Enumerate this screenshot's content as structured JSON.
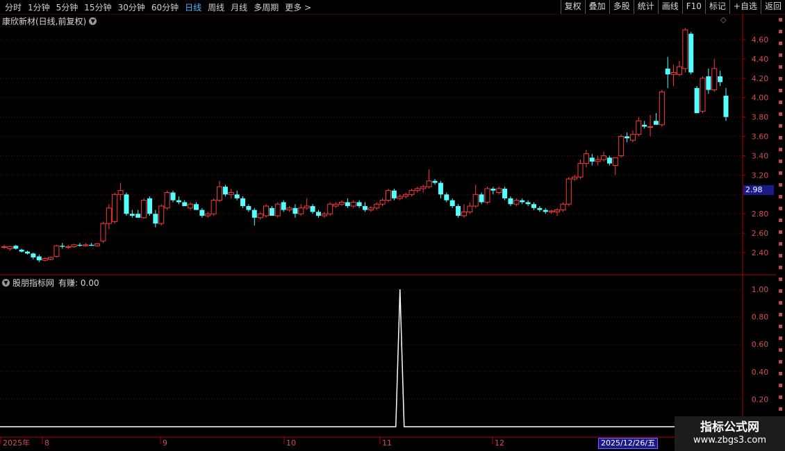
{
  "toolbar": {
    "periods": [
      "分时",
      "1分钟",
      "5分钟",
      "15分钟",
      "30分钟",
      "60分钟",
      "日线",
      "周线",
      "月线",
      "多周期",
      "更多 >"
    ],
    "active_period": "日线",
    "actions": [
      "复权",
      "叠加",
      "多股",
      "统计",
      "画线",
      "F10",
      "标记",
      "+自选",
      "返回"
    ]
  },
  "stock": {
    "title": "康欣新材(日线,前复权)",
    "current_price_tag": "2.98"
  },
  "price_axis": {
    "labels": [
      "4.60",
      "4.40",
      "4.20",
      "4.00",
      "3.80",
      "3.60",
      "3.40",
      "3.20",
      "2.80",
      "2.60",
      "2.40"
    ]
  },
  "indicator": {
    "title": "股朋指标网",
    "value_text": "有赚: 0.00",
    "axis_labels": [
      "1.00",
      "0.80",
      "0.60",
      "0.40",
      "0.20"
    ]
  },
  "date_axis": {
    "labels": [
      "2025年",
      "8",
      "9",
      "10",
      "11",
      "12"
    ],
    "selected_date": "2025/12/26/五"
  },
  "watermark": {
    "title": "指标公式网",
    "url": "www.zbgs3.com"
  },
  "colors": {
    "up": "#ff3b3b",
    "down": "#54ffff",
    "grid": "#800000",
    "indicator_line": "#ffffff",
    "active": "#4fb4ff"
  },
  "chart_data": {
    "type": "candlestick",
    "title": "康欣新材(日线,前复权)",
    "ylim": [
      2.25,
      4.8
    ],
    "candles": [
      {
        "o": 2.46,
        "h": 2.48,
        "l": 2.44,
        "c": 2.46
      },
      {
        "o": 2.44,
        "h": 2.47,
        "l": 2.42,
        "c": 2.46
      },
      {
        "o": 2.47,
        "h": 2.48,
        "l": 2.43,
        "c": 2.44
      },
      {
        "o": 2.43,
        "h": 2.44,
        "l": 2.4,
        "c": 2.41
      },
      {
        "o": 2.41,
        "h": 2.42,
        "l": 2.38,
        "c": 2.39
      },
      {
        "o": 2.39,
        "h": 2.4,
        "l": 2.33,
        "c": 2.35
      },
      {
        "o": 2.36,
        "h": 2.38,
        "l": 2.3,
        "c": 2.32
      },
      {
        "o": 2.32,
        "h": 2.35,
        "l": 2.31,
        "c": 2.34
      },
      {
        "o": 2.33,
        "h": 2.36,
        "l": 2.32,
        "c": 2.35
      },
      {
        "o": 2.36,
        "h": 2.48,
        "l": 2.35,
        "c": 2.47
      },
      {
        "o": 2.47,
        "h": 2.5,
        "l": 2.44,
        "c": 2.46
      },
      {
        "o": 2.46,
        "h": 2.48,
        "l": 2.44,
        "c": 2.46
      },
      {
        "o": 2.46,
        "h": 2.49,
        "l": 2.45,
        "c": 2.48
      },
      {
        "o": 2.48,
        "h": 2.5,
        "l": 2.46,
        "c": 2.47
      },
      {
        "o": 2.47,
        "h": 2.5,
        "l": 2.46,
        "c": 2.48
      },
      {
        "o": 2.48,
        "h": 2.5,
        "l": 2.47,
        "c": 2.47
      },
      {
        "o": 2.47,
        "h": 2.5,
        "l": 2.46,
        "c": 2.49
      },
      {
        "o": 2.52,
        "h": 2.72,
        "l": 2.5,
        "c": 2.7
      },
      {
        "o": 2.7,
        "h": 2.9,
        "l": 2.64,
        "c": 2.86
      },
      {
        "o": 2.72,
        "h": 3.02,
        "l": 2.7,
        "c": 3.0
      },
      {
        "o": 3.0,
        "h": 3.12,
        "l": 2.94,
        "c": 3.04
      },
      {
        "o": 3.0,
        "h": 3.02,
        "l": 2.78,
        "c": 2.8
      },
      {
        "o": 2.8,
        "h": 2.84,
        "l": 2.76,
        "c": 2.78
      },
      {
        "o": 2.8,
        "h": 2.84,
        "l": 2.76,
        "c": 2.76
      },
      {
        "o": 2.76,
        "h": 2.96,
        "l": 2.75,
        "c": 2.94
      },
      {
        "o": 2.96,
        "h": 2.98,
        "l": 2.78,
        "c": 2.8
      },
      {
        "o": 2.8,
        "h": 2.84,
        "l": 2.66,
        "c": 2.7
      },
      {
        "o": 2.7,
        "h": 2.9,
        "l": 2.68,
        "c": 2.88
      },
      {
        "o": 2.86,
        "h": 3.04,
        "l": 2.84,
        "c": 3.02
      },
      {
        "o": 3.02,
        "h": 3.04,
        "l": 2.92,
        "c": 2.94
      },
      {
        "o": 2.94,
        "h": 2.98,
        "l": 2.9,
        "c": 2.92
      },
      {
        "o": 2.92,
        "h": 2.94,
        "l": 2.88,
        "c": 2.88
      },
      {
        "o": 2.86,
        "h": 2.92,
        "l": 2.84,
        "c": 2.9
      },
      {
        "o": 2.9,
        "h": 2.92,
        "l": 2.84,
        "c": 2.84
      },
      {
        "o": 2.84,
        "h": 2.86,
        "l": 2.76,
        "c": 2.78
      },
      {
        "o": 2.78,
        "h": 2.82,
        "l": 2.76,
        "c": 2.8
      },
      {
        "o": 2.8,
        "h": 2.96,
        "l": 2.78,
        "c": 2.94
      },
      {
        "o": 2.94,
        "h": 3.14,
        "l": 2.92,
        "c": 3.08
      },
      {
        "o": 3.08,
        "h": 3.1,
        "l": 2.98,
        "c": 3.0
      },
      {
        "o": 3.0,
        "h": 3.06,
        "l": 2.96,
        "c": 3.02
      },
      {
        "o": 3.0,
        "h": 3.04,
        "l": 2.94,
        "c": 2.96
      },
      {
        "o": 2.96,
        "h": 2.98,
        "l": 2.86,
        "c": 2.88
      },
      {
        "o": 2.88,
        "h": 2.9,
        "l": 2.82,
        "c": 2.84
      },
      {
        "o": 2.84,
        "h": 2.86,
        "l": 2.68,
        "c": 2.76
      },
      {
        "o": 2.76,
        "h": 2.82,
        "l": 2.74,
        "c": 2.8
      },
      {
        "o": 2.78,
        "h": 2.9,
        "l": 2.76,
        "c": 2.88
      },
      {
        "o": 2.86,
        "h": 2.88,
        "l": 2.78,
        "c": 2.78
      },
      {
        "o": 2.78,
        "h": 2.92,
        "l": 2.76,
        "c": 2.9
      },
      {
        "o": 2.92,
        "h": 2.94,
        "l": 2.82,
        "c": 2.84
      },
      {
        "o": 2.84,
        "h": 2.88,
        "l": 2.82,
        "c": 2.86
      },
      {
        "o": 2.86,
        "h": 2.9,
        "l": 2.76,
        "c": 2.8
      },
      {
        "o": 2.8,
        "h": 2.9,
        "l": 2.78,
        "c": 2.86
      },
      {
        "o": 2.86,
        "h": 2.96,
        "l": 2.84,
        "c": 2.88
      },
      {
        "o": 2.88,
        "h": 2.9,
        "l": 2.8,
        "c": 2.82
      },
      {
        "o": 2.82,
        "h": 2.84,
        "l": 2.76,
        "c": 2.78
      },
      {
        "o": 2.78,
        "h": 2.82,
        "l": 2.76,
        "c": 2.8
      },
      {
        "o": 2.8,
        "h": 2.92,
        "l": 2.78,
        "c": 2.9
      },
      {
        "o": 2.88,
        "h": 2.92,
        "l": 2.86,
        "c": 2.9
      },
      {
        "o": 2.9,
        "h": 2.94,
        "l": 2.88,
        "c": 2.92
      },
      {
        "o": 2.92,
        "h": 2.96,
        "l": 2.86,
        "c": 2.88
      },
      {
        "o": 2.88,
        "h": 2.94,
        "l": 2.86,
        "c": 2.92
      },
      {
        "o": 2.92,
        "h": 2.94,
        "l": 2.86,
        "c": 2.88
      },
      {
        "o": 2.88,
        "h": 2.92,
        "l": 2.82,
        "c": 2.84
      },
      {
        "o": 2.84,
        "h": 2.88,
        "l": 2.82,
        "c": 2.86
      },
      {
        "o": 2.86,
        "h": 2.92,
        "l": 2.84,
        "c": 2.9
      },
      {
        "o": 2.9,
        "h": 2.96,
        "l": 2.88,
        "c": 2.94
      },
      {
        "o": 2.94,
        "h": 3.06,
        "l": 2.92,
        "c": 3.04
      },
      {
        "o": 3.04,
        "h": 3.06,
        "l": 2.94,
        "c": 2.96
      },
      {
        "o": 2.96,
        "h": 3.0,
        "l": 2.94,
        "c": 2.98
      },
      {
        "o": 2.98,
        "h": 3.02,
        "l": 2.96,
        "c": 3.0
      },
      {
        "o": 3.0,
        "h": 3.06,
        "l": 2.98,
        "c": 3.04
      },
      {
        "o": 3.04,
        "h": 3.08,
        "l": 3.02,
        "c": 3.06
      },
      {
        "o": 3.06,
        "h": 3.1,
        "l": 3.02,
        "c": 3.08
      },
      {
        "o": 3.08,
        "h": 3.26,
        "l": 3.06,
        "c": 3.14
      },
      {
        "o": 3.14,
        "h": 3.16,
        "l": 3.1,
        "c": 3.12
      },
      {
        "o": 3.12,
        "h": 3.14,
        "l": 2.96,
        "c": 3.0
      },
      {
        "o": 3.0,
        "h": 3.02,
        "l": 2.92,
        "c": 2.94
      },
      {
        "o": 2.94,
        "h": 2.96,
        "l": 2.86,
        "c": 2.88
      },
      {
        "o": 2.88,
        "h": 2.9,
        "l": 2.76,
        "c": 2.78
      },
      {
        "o": 2.78,
        "h": 2.9,
        "l": 2.76,
        "c": 2.82
      },
      {
        "o": 2.82,
        "h": 2.92,
        "l": 2.8,
        "c": 2.88
      },
      {
        "o": 2.88,
        "h": 3.1,
        "l": 2.86,
        "c": 3.0
      },
      {
        "o": 3.0,
        "h": 3.02,
        "l": 2.9,
        "c": 2.92
      },
      {
        "o": 2.92,
        "h": 3.08,
        "l": 2.9,
        "c": 3.06
      },
      {
        "o": 3.06,
        "h": 3.08,
        "l": 3.0,
        "c": 3.04
      },
      {
        "o": 3.02,
        "h": 3.08,
        "l": 3.0,
        "c": 3.06
      },
      {
        "o": 3.06,
        "h": 3.08,
        "l": 2.94,
        "c": 2.96
      },
      {
        "o": 2.96,
        "h": 2.98,
        "l": 2.88,
        "c": 2.9
      },
      {
        "o": 2.9,
        "h": 2.96,
        "l": 2.88,
        "c": 2.94
      },
      {
        "o": 2.94,
        "h": 2.96,
        "l": 2.9,
        "c": 2.92
      },
      {
        "o": 2.92,
        "h": 2.94,
        "l": 2.88,
        "c": 2.9
      },
      {
        "o": 2.9,
        "h": 2.92,
        "l": 2.84,
        "c": 2.86
      },
      {
        "o": 2.86,
        "h": 2.88,
        "l": 2.82,
        "c": 2.84
      },
      {
        "o": 2.84,
        "h": 2.86,
        "l": 2.8,
        "c": 2.82
      },
      {
        "o": 2.82,
        "h": 2.84,
        "l": 2.8,
        "c": 2.83
      },
      {
        "o": 2.82,
        "h": 2.86,
        "l": 2.78,
        "c": 2.84
      },
      {
        "o": 2.84,
        "h": 2.92,
        "l": 2.82,
        "c": 2.9
      },
      {
        "o": 2.9,
        "h": 3.18,
        "l": 2.88,
        "c": 3.16
      },
      {
        "o": 3.16,
        "h": 3.2,
        "l": 3.14,
        "c": 3.18
      },
      {
        "o": 3.18,
        "h": 3.36,
        "l": 3.16,
        "c": 3.32
      },
      {
        "o": 3.32,
        "h": 3.46,
        "l": 3.28,
        "c": 3.42
      },
      {
        "o": 3.38,
        "h": 3.42,
        "l": 3.3,
        "c": 3.34
      },
      {
        "o": 3.34,
        "h": 3.4,
        "l": 3.3,
        "c": 3.36
      },
      {
        "o": 3.36,
        "h": 3.44,
        "l": 3.34,
        "c": 3.4
      },
      {
        "o": 3.38,
        "h": 3.4,
        "l": 3.3,
        "c": 3.32
      },
      {
        "o": 3.3,
        "h": 3.38,
        "l": 3.2,
        "c": 3.38
      },
      {
        "o": 3.4,
        "h": 3.62,
        "l": 3.38,
        "c": 3.6
      },
      {
        "o": 3.6,
        "h": 3.64,
        "l": 3.54,
        "c": 3.58
      },
      {
        "o": 3.56,
        "h": 3.66,
        "l": 3.54,
        "c": 3.62
      },
      {
        "o": 3.62,
        "h": 3.8,
        "l": 3.6,
        "c": 3.76
      },
      {
        "o": 3.72,
        "h": 3.76,
        "l": 3.68,
        "c": 3.7
      },
      {
        "o": 3.7,
        "h": 3.82,
        "l": 3.6,
        "c": 3.7
      },
      {
        "o": 3.76,
        "h": 3.84,
        "l": 3.72,
        "c": 3.72
      },
      {
        "o": 3.72,
        "h": 4.08,
        "l": 3.7,
        "c": 4.06
      },
      {
        "o": 4.3,
        "h": 4.42,
        "l": 4.1,
        "c": 4.24
      },
      {
        "o": 4.24,
        "h": 4.34,
        "l": 4.12,
        "c": 4.26
      },
      {
        "o": 4.24,
        "h": 4.38,
        "l": 4.22,
        "c": 4.32
      },
      {
        "o": 4.3,
        "h": 4.72,
        "l": 4.26,
        "c": 4.7
      },
      {
        "o": 4.66,
        "h": 4.68,
        "l": 4.24,
        "c": 4.26
      },
      {
        "o": 4.1,
        "h": 4.12,
        "l": 3.86,
        "c": 3.84
      },
      {
        "o": 3.86,
        "h": 4.22,
        "l": 3.84,
        "c": 4.2
      },
      {
        "o": 4.22,
        "h": 4.3,
        "l": 4.04,
        "c": 4.08
      },
      {
        "o": 4.08,
        "h": 4.4,
        "l": 4.06,
        "c": 4.3
      },
      {
        "o": 4.22,
        "h": 4.28,
        "l": 4.12,
        "c": 4.16
      },
      {
        "o": 4.02,
        "h": 4.1,
        "l": 3.76,
        "c": 3.8
      }
    ],
    "indicator": {
      "name": "有赚",
      "ylim": [
        0,
        1.05
      ],
      "spike_index": 68,
      "spike_value": 1.0
    }
  }
}
